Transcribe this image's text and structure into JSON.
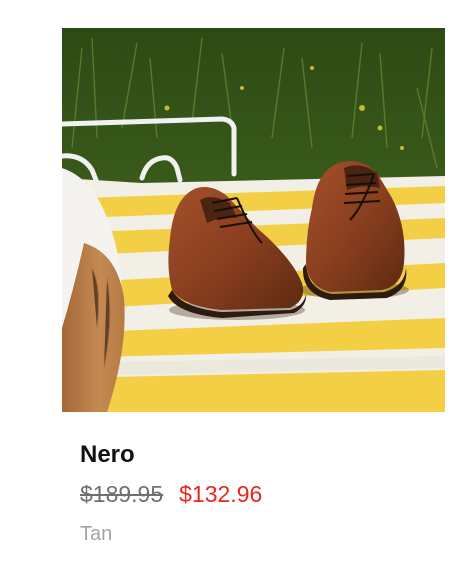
{
  "product": {
    "name": "Nero",
    "original_price": "$189.95",
    "sale_price": "$132.96",
    "color": "Tan",
    "image_alt": "Tan leather lace-up shoes on a yellow and white striped blanket in the grass"
  },
  "colors": {
    "sale_price": "#e8281f",
    "original_price": "#6f6f6f",
    "color_label": "#a3a3a3",
    "name": "#111111"
  }
}
